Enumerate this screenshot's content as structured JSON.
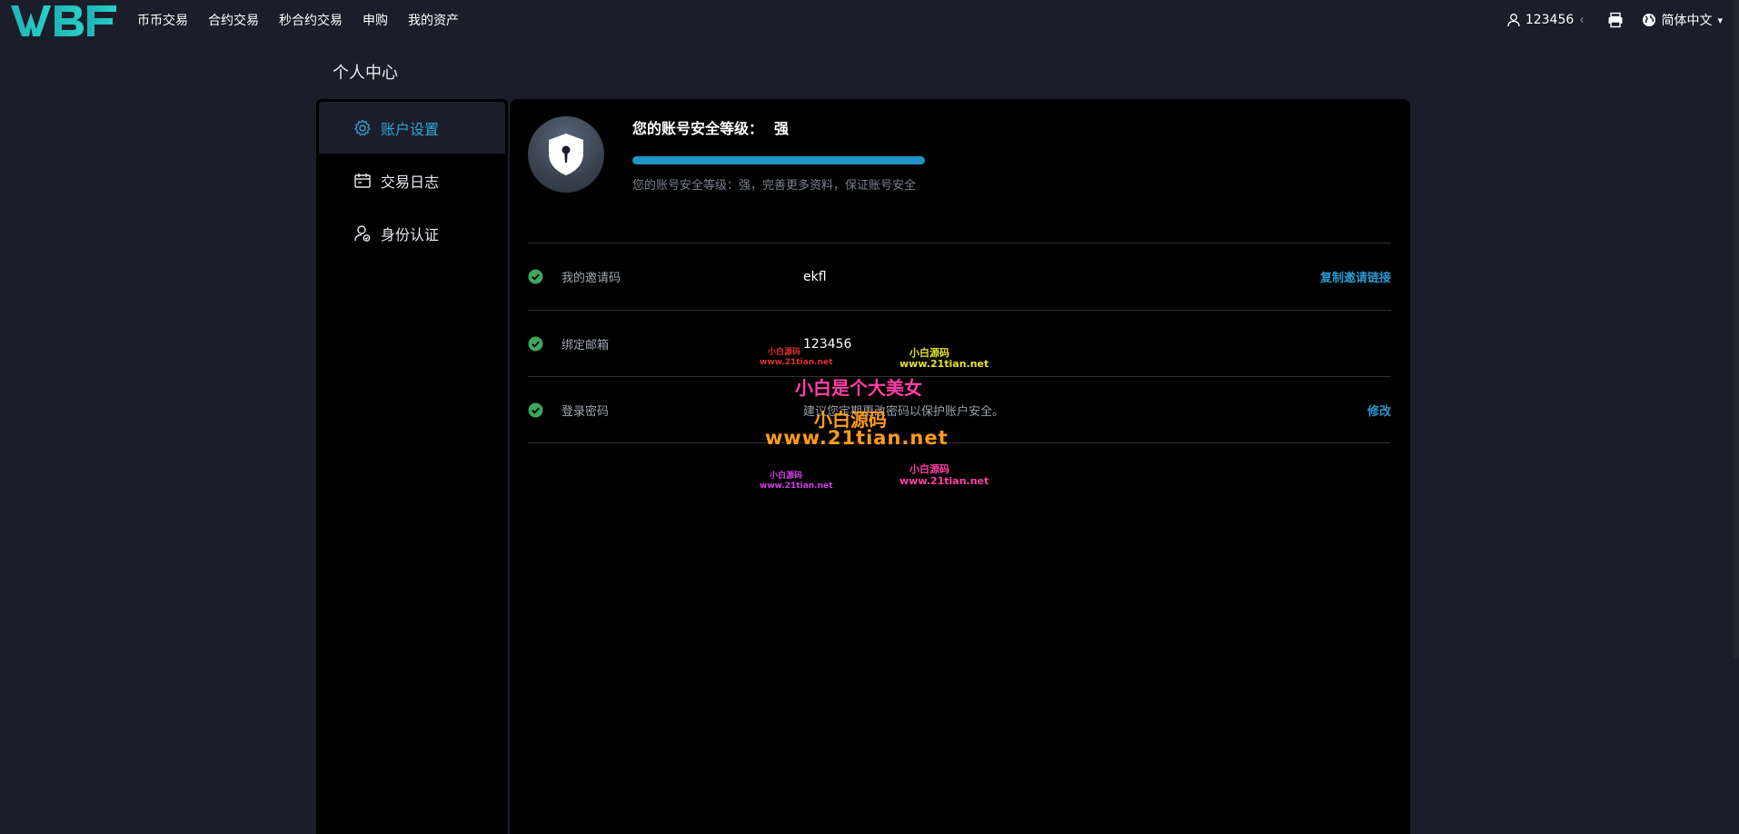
{
  "header": {
    "logo_text": "WBF",
    "nav": [
      "币币交易",
      "合约交易",
      "秒合约交易",
      "申购",
      "我的资产"
    ],
    "user_label": "123456",
    "user_chevron": "‹",
    "language": "简体中文",
    "language_chevron": "▾"
  },
  "page": {
    "title": "个人中心"
  },
  "sidebar": {
    "items": [
      {
        "label": "账户设置",
        "icon": "gear-icon",
        "active": true
      },
      {
        "label": "交易日志",
        "icon": "calendar-icon",
        "active": false
      },
      {
        "label": "身份认证",
        "icon": "user-verify-icon",
        "active": false
      }
    ]
  },
  "security": {
    "title_prefix": "您的账号安全等级：",
    "level": "强",
    "progress_percent": 100,
    "description": "您的账号安全等级：强，完善更多资料，保证账号安全"
  },
  "rows": [
    {
      "label": "我的邀请码",
      "value": "ekfl",
      "action": "复制邀请链接"
    },
    {
      "label": "绑定邮箱",
      "value": "123456",
      "action": ""
    },
    {
      "label": "登录密码",
      "value": "建议您定期更改密码以保护账户安全。",
      "action": "修改"
    }
  ],
  "watermark": {
    "line_cn_small": "小白源码",
    "line_url_small": "www.21tian.net",
    "line_big": "小白是个大美女",
    "line_big_url": "www.21tian.net"
  },
  "colors": {
    "accent": "#2fa4d6",
    "check": "#3ea65a",
    "background": "#1b1d2a",
    "panel": "#000000"
  }
}
